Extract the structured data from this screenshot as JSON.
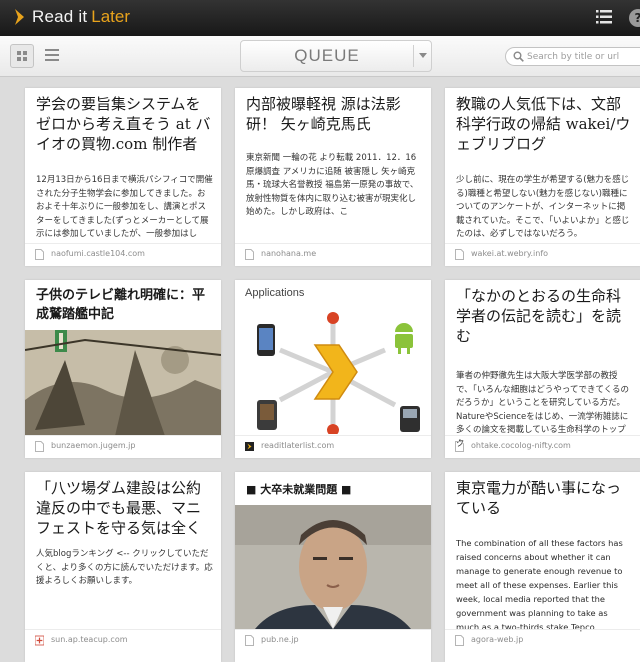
{
  "header": {
    "logo_read": "Read it",
    "logo_later": "Later",
    "help_label": "?"
  },
  "toolbar": {
    "queue_label": "QUEUE",
    "search_placeholder": "Search by title or url"
  },
  "colors": {
    "brand_orange": "#e8a31c",
    "topbar": "#222222",
    "background": "#dcdcdc"
  },
  "cards": [
    {
      "title": "学会の要旨集システムをゼロから考え直そう at バイオの買物.com 制作者",
      "excerpt": "12月13日から16日まで横浜パシフィコで開催された分子生物学会に参加してきました。おおよそ十年ぶりに一般参加をし、講演とポスターをしてきました(ずっとメーカーとして展示には参加していましたが、一般参加はし",
      "domain": "naofumi.castle104.com"
    },
    {
      "title": "内部被曝軽視 源は法影研！ 矢ヶ崎克馬氏",
      "excerpt": "東京新聞 一輪の花 より転載 2011．12．16 原爆調査 アメリカに追随 被害隠し 矢ヶ崎克馬・琉球大名誉教授 福島第一原発の事故で、放射性物質を体内に取り込む被害が現実化し始めた。しかし政府は、こ",
      "domain": "nanohana.me"
    },
    {
      "title": "教職の人気低下は、文部科学行政の帰結 wakei/ウェブリブログ",
      "excerpt": "少し前に、現在の学生が希望する(魅力を感じる)職種と希望しない(魅力を感じない)職種についてのアンケートが、インターネットに掲載されていた。そこで、「いよいよか」と感じたのは、必ずしではないだろう。",
      "domain": "wakei.at.webry.info"
    },
    {
      "title": "子供のテレビ離れ明確に：平成鷲踏艦中記",
      "domain": "bunzaemon.jugem.jp"
    },
    {
      "title": "Applications",
      "domain": "readitlaterlist.com"
    },
    {
      "title": "「なかのとおるの生命科学者の伝記を読む」を読む",
      "excerpt": "筆者の仲野徹先生は大阪大学医学部の教授で、「いろんな細胞はどうやってできてくるのだろうか」ということを研究している方だ。NatureやScienceをはじめ、一流学術雑誌に多くの論文を掲載している生命科学のトップク",
      "domain": "ohtake.cocolog-nifty.com"
    },
    {
      "title": "「八ツ場ダム建設は公約違反の中でも最悪、マニフェストを守る気は全くな",
      "excerpt": "人気blogランキング <-- クリックしていただくと、より多くの方に読んでいただけます。応援よろしくお願いします。",
      "domain": "sun.ap.teacup.com"
    },
    {
      "title": "■ 大卒未就業問題 ■",
      "domain": "pub.ne.jp"
    },
    {
      "title": "東京電力が酷い事になっている",
      "excerpt": "The combination of all these factors has raised concerns about whether it can manage to generate enough revenue to meet all of these expenses. Earlier this week, local media reported that the government was planning to take as much as a two-thirds stake Tepco.",
      "domain": "agora-web.jp"
    }
  ]
}
